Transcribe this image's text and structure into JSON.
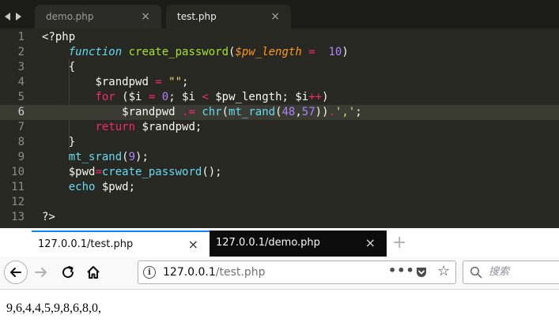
{
  "editor": {
    "tabs": [
      {
        "label": "demo.php",
        "active": false
      },
      {
        "label": "test.php",
        "active": true
      }
    ],
    "close_glyph": "×",
    "line_numbers": [
      "1",
      "2",
      "3",
      "4",
      "5",
      "6",
      "7",
      "8",
      "9",
      "10",
      "11",
      "12",
      "13"
    ],
    "current_line": 6,
    "code": {
      "l1": "<?php",
      "l2": {
        "kw": "function",
        "name": "create_password",
        "open": "(",
        "param": "$pw_length",
        "eq": " = ",
        "num": " 10",
        "close": ")"
      },
      "l3": "{",
      "l4": {
        "var": "$randpwd ",
        "op": "=",
        "str": " \"\"",
        "end": ";"
      },
      "l5": {
        "kw": "for",
        "a": " ($i ",
        "op1": "=",
        "n0": " 0",
        "b": "; $i ",
        "op2": "<",
        "c": " $pw_length; $i",
        "op3": "++",
        "d": ")"
      },
      "l6": {
        "var": "$randpwd ",
        "op": ".=",
        "sp": " ",
        "fn1": "chr",
        "o1": "(",
        "fn2": "mt_rand",
        "o2": "(",
        "n1": "48",
        "comma": ",",
        "n2": "57",
        "c2": "))",
        "dot": ".",
        "str": "','",
        "end": ";"
      },
      "l7": {
        "kw": "return",
        "rest": " $randpwd;"
      },
      "l8": "}",
      "l9": {
        "fn": "mt_srand",
        "o": "(",
        "num": "9",
        "c": ");"
      },
      "l10": {
        "var": "$pwd",
        "op": "=",
        "fn": "create_password",
        "rest": "();"
      },
      "l11": {
        "kw": "echo",
        "rest": " $pwd;"
      },
      "l12": "",
      "l13": "?>"
    }
  },
  "browser": {
    "tabs": [
      {
        "label": "127.0.0.1/test.php",
        "active": true
      },
      {
        "label": "127.0.0.1/demo.php",
        "active": false
      }
    ],
    "close_glyph": "×",
    "new_tab": "+",
    "info_glyph": "i",
    "url_host": "127.0.0.1",
    "url_path": "/test.php",
    "page_actions": "•••",
    "star": "☆",
    "search_placeholder": "搜索",
    "page_output": "9,6,4,4,5,9,8,6,8,0,"
  },
  "colors": {
    "editor_bg": "#272822",
    "keyword": "#f92672",
    "function": "#a6e22e",
    "string": "#e6db74",
    "number": "#ae81ff",
    "storage": "#66d9ef",
    "parameter": "#fd971f",
    "browser_accent": "#0a84ff",
    "browser_dark_tab": "#0c0c0d"
  },
  "icons": [
    "nav-left-icon",
    "nav-right-icon",
    "close-icon",
    "back-arrow-icon",
    "forward-arrow-icon",
    "reload-icon",
    "home-icon",
    "info-icon",
    "pocket-icon",
    "star-icon",
    "search-icon",
    "plus-icon"
  ]
}
